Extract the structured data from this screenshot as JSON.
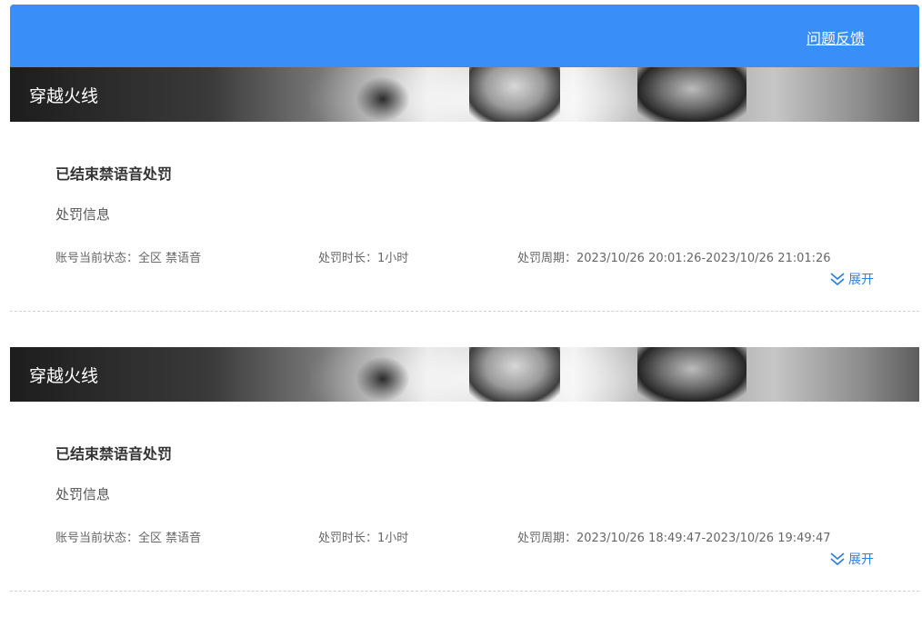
{
  "header": {
    "feedback_label": "问题反馈",
    "bg_color": "#3a8ef8"
  },
  "records": [
    {
      "game": "穿越火线",
      "status_title": "已结束禁语音处罚",
      "section_label": "处罚信息",
      "account_status": "账号当前状态：全区 禁语音",
      "duration": "处罚时长：1小时",
      "period": "处罚周期：2023/10/26 20:01:26-2023/10/26 21:01:26",
      "expand_label": "展开"
    },
    {
      "game": "穿越火线",
      "status_title": "已结束禁语音处罚",
      "section_label": "处罚信息",
      "account_status": "账号当前状态：全区 禁语音",
      "duration": "处罚时长：1小时",
      "period": "处罚周期：2023/10/26 18:49:47-2023/10/26 19:49:47",
      "expand_label": "展开"
    }
  ],
  "icons": {
    "expand": "double-chevron-down-icon"
  }
}
